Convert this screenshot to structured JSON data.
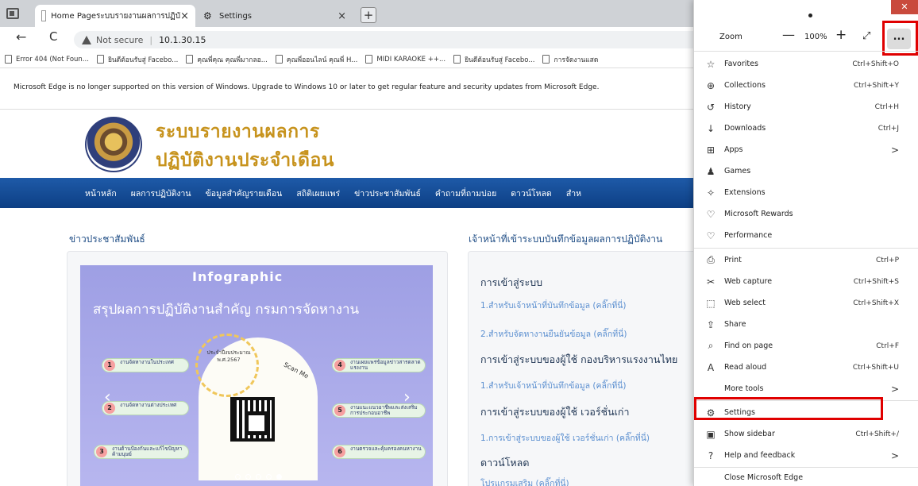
{
  "browser": {
    "tabs": [
      {
        "title": "Home Pageระบบรายงานผลการปฏิบั",
        "close": "×"
      },
      {
        "title": "Settings",
        "close": "×"
      }
    ],
    "new_tab": "+",
    "nav": {
      "back": "←",
      "refresh": "C"
    },
    "address": {
      "security": "Not secure",
      "separator": "|",
      "url": "10.1.30.15"
    },
    "favorites": [
      "Error 404 (Not Foun...",
      "ยินดีต้อนรับสู่ Facebo...",
      "คุณพี่คุณ คุณพี่มากลอ...",
      "คุณพี่ออนไลน์ คุณพี่ H...",
      "MIDI KARAOKE ++...",
      "ยินดีต้อนรับสู่ Facebo...",
      "การจัดงานแสด"
    ],
    "favorites_more": ">",
    "infobar": {
      "text": "Microsoft Edge is no longer supported on this version of Windows. Upgrade to Windows 10 or later to get regular feature and security updates from Microsoft Edge.",
      "close": "×"
    }
  },
  "page": {
    "site_title_line1": "ระบบรายงานผลการ",
    "site_title_line2": "ปฏิบัติงานประจำเดือน",
    "nav_links": [
      "หน้าหลัก",
      "ผลการปฏิบัติงาน",
      "ข้อมูลสำคัญรายเดือน",
      "สถิติเผยแพร่",
      "ข่าวประชาสัมพันธ์",
      "คำถามที่ถามบ่อย",
      "ดาวน์โหลด",
      "สำห"
    ],
    "news_heading": "ข่าวประชาสัมพันธ์",
    "infographic": {
      "head": "Infographic",
      "title": "สรุปผลการปฏิบัติงานสำคัญ กรมการจัดหางาน",
      "circle_text": "ประจำปีงบประมาณ พ.ศ.2567",
      "scan": "Scan Me",
      "items": [
        {
          "num": "1",
          "text": "งานจัดหางานในประเทศ"
        },
        {
          "num": "2",
          "text": "งานจัดหางานต่างประเทศ"
        },
        {
          "num": "3",
          "text": "งานต้านป้องกันและแก้ไขปัญหาค้ามนุษย์"
        },
        {
          "num": "4",
          "text": "งานเผยแพร่ข้อมูลข่าวสารตลาดแรงงาน"
        },
        {
          "num": "5",
          "text": "งานแนะแนวอาชีพและส่งเสริมการประกอบอาชีพ"
        },
        {
          "num": "6",
          "text": "งานตรวจและคุ้มครองคนหางาน"
        }
      ],
      "prev": "‹",
      "next": "›"
    },
    "staff_heading": "เจ้าหน้าที่เข้าระบบบันทึกข้อมูลผลการปฏิบัติงาน",
    "login_sections": [
      {
        "heading": "การเข้าสู่ระบบ",
        "links": [
          "1.สำหรับเจ้าหน้าที่บันทึกข้อมูล (คลิ๊กที่นี่)",
          "2.สำหรับจัดหางานยืนยันข้อมูล (คลิ๊กที่นี่)"
        ]
      },
      {
        "heading": "การเข้าสู่ระบบของผู้ใช้ กองบริหารแรงงานไทย",
        "links": [
          "1.สำหรับเจ้าหน้าที่บันทึกข้อมูล (คลิ๊กที่นี่)"
        ]
      },
      {
        "heading": "การเข้าสู่ระบบของผู้ใช้ เวอร์ชั่นเก่า",
        "links": [
          "1.การเข้าสู่ระบบของผู้ใช้ เวอร์ชั่นเก่า (คลิ๊กที่นี่)"
        ]
      },
      {
        "heading": "ดาวน์โหลด",
        "links": [
          "โปรแกรมเสริม (คลิ๊กที่นี่)"
        ]
      }
    ]
  },
  "menu": {
    "zoom_label": "Zoom",
    "zoom_minus": "—",
    "zoom_value": "100%",
    "zoom_plus": "+",
    "fullscreen": "⤢",
    "more": "...",
    "items": [
      {
        "icon": "favorites-icon",
        "glyph": "☆",
        "label": "Favorites",
        "shortcut": "Ctrl+Shift+O"
      },
      {
        "icon": "collections-icon",
        "glyph": "⊕",
        "label": "Collections",
        "shortcut": "Ctrl+Shift+Y"
      },
      {
        "icon": "history-icon",
        "glyph": "↺",
        "label": "History",
        "shortcut": "Ctrl+H"
      },
      {
        "icon": "downloads-icon",
        "glyph": "↓",
        "label": "Downloads",
        "shortcut": "Ctrl+J"
      },
      {
        "icon": "apps-icon",
        "glyph": "⊞",
        "label": "Apps",
        "arrow": ">"
      },
      {
        "icon": "games-icon",
        "glyph": "♟",
        "label": "Games"
      },
      {
        "icon": "extensions-icon",
        "glyph": "✧",
        "label": "Extensions"
      },
      {
        "icon": "rewards-icon",
        "glyph": "♡",
        "label": "Microsoft Rewards"
      },
      {
        "icon": "performance-icon",
        "glyph": "♡",
        "label": "Performance"
      },
      {
        "icon": "print-icon",
        "glyph": "⎙",
        "label": "Print",
        "shortcut": "Ctrl+P"
      },
      {
        "icon": "web-capture-icon",
        "glyph": "✂",
        "label": "Web capture",
        "shortcut": "Ctrl+Shift+S"
      },
      {
        "icon": "web-select-icon",
        "glyph": "⬚",
        "label": "Web select",
        "shortcut": "Ctrl+Shift+X"
      },
      {
        "icon": "share-icon",
        "glyph": "⇪",
        "label": "Share"
      },
      {
        "icon": "find-icon",
        "glyph": "⌕",
        "label": "Find on page",
        "shortcut": "Ctrl+F"
      },
      {
        "icon": "read-aloud-icon",
        "glyph": "A",
        "label": "Read aloud",
        "shortcut": "Ctrl+Shift+U"
      },
      {
        "icon": "more-tools-icon",
        "glyph": "",
        "label": "More tools",
        "arrow": ">"
      },
      {
        "icon": "settings-icon",
        "glyph": "⚙",
        "label": "Settings"
      },
      {
        "icon": "sidebar-icon",
        "glyph": "▣",
        "label": "Show sidebar",
        "shortcut": "Ctrl+Shift+/"
      },
      {
        "icon": "help-icon",
        "glyph": "?",
        "label": "Help and feedback",
        "arrow": ">"
      },
      {
        "icon": "close-edge-icon",
        "glyph": "",
        "label": "Close Microsoft Edge"
      }
    ]
  },
  "colors": {
    "nav_blue": "#1e5aa8",
    "title_gold": "#c7931d",
    "link_blue": "#5b8fd0",
    "highlight_red": "#e00000"
  }
}
